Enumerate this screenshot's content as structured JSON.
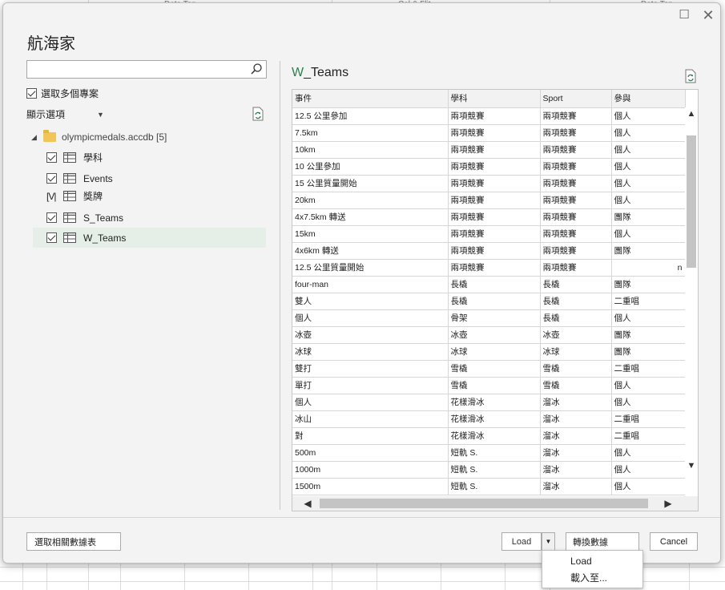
{
  "sheet": {
    "headers": [
      "Date Top",
      "Cal & Flit",
      "Date Top"
    ]
  },
  "dialog": {
    "title": "航海家",
    "maximize_glyph": "☐",
    "close_glyph": "✕"
  },
  "left": {
    "search": {
      "value": "",
      "placeholder": ""
    },
    "multi_select": {
      "label": "選取多個專案",
      "checked": true
    },
    "display_options": {
      "label": "顯示選項"
    },
    "tree": {
      "root": {
        "label": "olympicmedals.accdb [5]",
        "expanded": true
      },
      "items": [
        {
          "label": "學科",
          "checked": true
        },
        {
          "label": "Events",
          "checked": true
        },
        {
          "label": "獎牌",
          "checked": "partial",
          "partial_glyph": "[V|"
        },
        {
          "label": "S_Teams",
          "checked": true
        },
        {
          "label": "W_Teams",
          "checked": true,
          "selected": true
        }
      ]
    }
  },
  "preview": {
    "title_first": "W",
    "title_rest": "_Teams",
    "columns": [
      "事件",
      "學科",
      "Sport",
      "參與"
    ],
    "rows": [
      [
        "12.5 公里參加",
        "兩項競賽",
        "兩項競賽",
        "個人"
      ],
      [
        "7.5km",
        "兩項競賽",
        "兩項競賽",
        "個人"
      ],
      [
        "10km",
        "兩項競賽",
        "兩項競賽",
        "個人"
      ],
      [
        "10 公里參加",
        "兩項競賽",
        "兩項競賽",
        "個人"
      ],
      [
        "15 公里質量開始",
        "兩項競賽",
        "兩項競賽",
        "個人"
      ],
      [
        "20km",
        "兩項競賽",
        "兩項競賽",
        "個人"
      ],
      [
        "4x7.5km 轉送",
        "兩項競賽",
        "兩項競賽",
        "團隊"
      ],
      [
        "15km",
        "兩項競賽",
        "兩項競賽",
        "個人"
      ],
      [
        "4x6km 轉送",
        "兩項競賽",
        "兩項競賽",
        "團隊"
      ],
      [
        "12.5 公里質量開始",
        "兩項競賽",
        "兩項競賽",
        "n"
      ],
      [
        "four-man",
        "長橇",
        "長橇",
        "團隊"
      ],
      [
        "雙人",
        "長橇",
        "長橇",
        "二重唱"
      ],
      [
        "個人",
        "骨架",
        "長橇",
        "個人"
      ],
      [
        "冰壺",
        "冰壺",
        "冰壺",
        "團隊"
      ],
      [
        "冰球",
        "冰球",
        "冰球",
        "團隊"
      ],
      [
        "雙打",
        "雪橇",
        "雪橇",
        "二重唱"
      ],
      [
        "單打",
        "雪橇",
        "雪橇",
        "個人"
      ],
      [
        "個人",
        "花樣滑冰",
        "溜冰",
        "個人"
      ],
      [
        "冰山",
        "花樣滑冰",
        "溜冰",
        "二重唱"
      ],
      [
        "對",
        "花樣滑冰",
        "溜冰",
        "二重唱"
      ],
      [
        "500m",
        "短軌 S.",
        "溜冰",
        "個人"
      ],
      [
        "1000m",
        "短軌 S.",
        "溜冰",
        "個人"
      ],
      [
        "1500m",
        "短軌 S.",
        "溜冰",
        "個人"
      ]
    ]
  },
  "footer": {
    "related_tables_label": "選取相關數據表",
    "load_label": "Load",
    "transform_label": "轉換數據",
    "cancel_label": "Cancel"
  },
  "load_menu": {
    "items": [
      "Load",
      "載入至..."
    ]
  },
  "colors": {
    "accent": "#2f7d4f",
    "selected_row": "#e5efe8",
    "folder": "#f0c659"
  }
}
